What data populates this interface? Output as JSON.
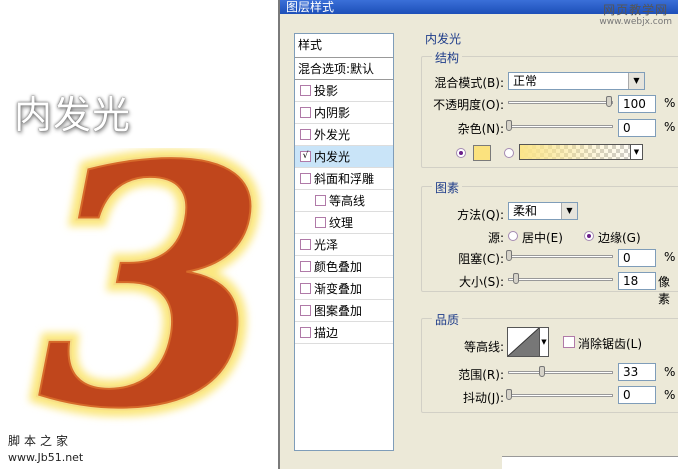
{
  "artwork": {
    "title": "内发光",
    "digit": "3",
    "site_cn": "脚本之家",
    "site_url": "www.Jb51.net"
  },
  "dialog": {
    "title": "图层样式",
    "watermark_cn": "网页教学网",
    "watermark_url": "www.webjx.com"
  },
  "style_list": {
    "header": "样式",
    "blend": "混合选项:默认",
    "items": [
      {
        "label": "投影",
        "checked": false
      },
      {
        "label": "内阴影",
        "checked": false
      },
      {
        "label": "外发光",
        "checked": false
      },
      {
        "label": "内发光",
        "checked": true,
        "selected": true
      },
      {
        "label": "斜面和浮雕",
        "checked": false
      },
      {
        "label": "等高线",
        "checked": false,
        "indent": true
      },
      {
        "label": "纹理",
        "checked": false,
        "indent": true
      },
      {
        "label": "光泽",
        "checked": false
      },
      {
        "label": "颜色叠加",
        "checked": false
      },
      {
        "label": "渐变叠加",
        "checked": false
      },
      {
        "label": "图案叠加",
        "checked": false
      },
      {
        "label": "描边",
        "checked": false
      }
    ],
    "check_mark": "√"
  },
  "inner_glow": {
    "section_title": "内发光",
    "structure": {
      "title": "结构",
      "blend_mode_label": "混合模式(B):",
      "blend_mode_value": "正常",
      "opacity_label": "不透明度(O):",
      "opacity_value": "100",
      "opacity_level": 1.0,
      "noise_label": "杂色(N):",
      "noise_value": "0",
      "noise_level": 0.0,
      "unit": "%",
      "glow_color": "#fbe27e"
    },
    "elements": {
      "title": "图素",
      "technique_label": "方法(Q):",
      "technique_value": "柔和",
      "source_label": "源:",
      "source_center": "居中(E)",
      "source_edge": "边缘(G)",
      "choke_label": "阻塞(C):",
      "choke_value": "0",
      "choke_level": 0.0,
      "size_label": "大小(S):",
      "size_value": "18",
      "size_level": 0.072,
      "size_unit": "像素",
      "unit": "%"
    },
    "quality": {
      "title": "品质",
      "contour_label": "等高线:",
      "antialias_label": "消除锯齿(L)",
      "range_label": "范围(R):",
      "range_value": "33",
      "range_level": 0.33,
      "jitter_label": "抖动(J):",
      "jitter_value": "0",
      "jitter_level": 0.0,
      "unit": "%"
    }
  },
  "colors": {
    "glow_yellow": "#fbe27e",
    "digit_red": "#c0461c",
    "selection_blue": "#c9e4f8",
    "panel_bg": "#ece9d8"
  }
}
